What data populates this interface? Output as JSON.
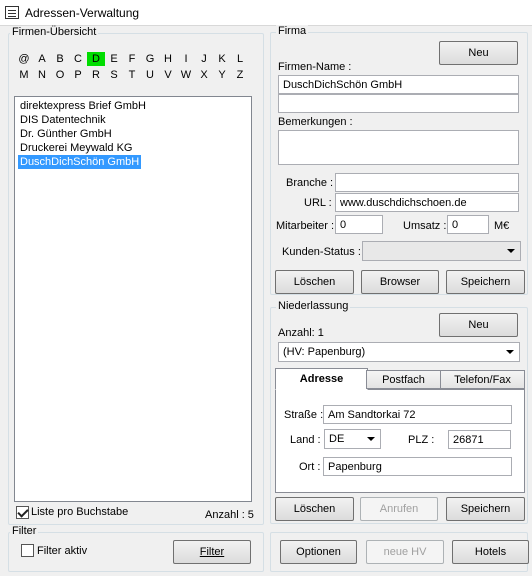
{
  "window": {
    "title": "Adressen-Verwaltung"
  },
  "overview": {
    "label": "Firmen-Übersicht",
    "letters_row1": [
      "@",
      "A",
      "B",
      "C",
      "D",
      "E",
      "F",
      "G",
      "H",
      "I",
      "J",
      "K",
      "L"
    ],
    "letters_row2": [
      "M",
      "N",
      "O",
      "P",
      "R",
      "S",
      "T",
      "U",
      "V",
      "W",
      "X",
      "Y",
      "Z"
    ],
    "active_letter": "D",
    "companies": [
      "direktexpress Brief GmbH",
      "DIS Datentechnik",
      "Dr. Günther GmbH",
      "Druckerei Meywald KG",
      "DuschDichSchön GmbH"
    ],
    "selected_index": 4,
    "per_letter_label": "Liste pro Buchstabe",
    "per_letter_checked": true,
    "count_label": "Anzahl : 5"
  },
  "filter": {
    "label": "Filter",
    "active_label": "Filter aktiv",
    "active_checked": false,
    "button_label": "Filter"
  },
  "company": {
    "group_label": "Firma",
    "new_button": "Neu",
    "name_label": "Firmen-Name :",
    "name_value": "DuschDichSchön GmbH",
    "name2_value": "",
    "remarks_label": "Bemerkungen :",
    "remarks_value": "",
    "branch_label": "Branche :",
    "branch_value": "",
    "url_label": "URL :",
    "url_value": "www.duschdichschoen.de",
    "employees_label": "Mitarbeiter :",
    "employees_value": "0",
    "revenue_label": "Umsatz :",
    "revenue_value": "0",
    "revenue_unit": "M€",
    "status_label": "Kunden-Status :",
    "status_value": "",
    "delete_button": "Löschen",
    "browser_button": "Browser",
    "save_button": "Speichern"
  },
  "branch": {
    "group_label": "Niederlassung",
    "count_label": "Anzahl: 1",
    "new_button": "Neu",
    "selected": "(HV: Papenburg)",
    "tabs": [
      "Adresse",
      "Postfach",
      "Telefon/Fax"
    ],
    "active_tab": 0,
    "street_label": "Straße :",
    "street_value": "Am Sandtorkai 72",
    "country_label": "Land :",
    "country_value": "DE",
    "zip_label": "PLZ :",
    "zip_value": "26871",
    "city_label": "Ort :",
    "city_value": "Papenburg",
    "delete_button": "Löschen",
    "call_button": "Anrufen",
    "save_button": "Speichern"
  },
  "footer": {
    "options_button": "Optionen",
    "new_hv_button": "neue HV",
    "hotels_button": "Hotels"
  },
  "colors": {
    "active_letter": "#00dd00",
    "selection": "#3399ff"
  }
}
